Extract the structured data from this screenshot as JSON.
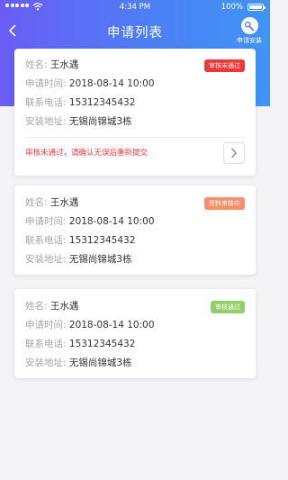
{
  "status_bar": {
    "time": "4:34 PM",
    "battery": "100%"
  },
  "nav": {
    "title": "申请列表",
    "apply_label": "申请安装"
  },
  "field_labels": {
    "name": "姓名:",
    "time": "申请时间:",
    "phone": "联系电话:",
    "address": "安装地址:"
  },
  "cards": [
    {
      "name": "王水遇",
      "time": "2018-08-14  10:00",
      "phone": "15312345432",
      "address": "无锡尚锦城3栋",
      "status": "审核未通过",
      "status_color": "#f33737",
      "message": "审核未通过，请确认无误后重新提交"
    },
    {
      "name": "王水遇",
      "time": "2018-08-14  10:00",
      "phone": "15312345432",
      "address": "无锡尚锦城3栋",
      "status": "资料审核中",
      "status_color": "#f9906a"
    },
    {
      "name": "王水遇",
      "time": "2018-08-14  10:00",
      "phone": "15312345432",
      "address": "无锡尚锦城3栋",
      "status": "审核通过",
      "status_color": "#94d06a"
    }
  ],
  "icons": [
    "signal-icon",
    "wifi-icon",
    "battery-icon",
    "back-icon",
    "wrench-icon",
    "chevron-right-icon"
  ]
}
